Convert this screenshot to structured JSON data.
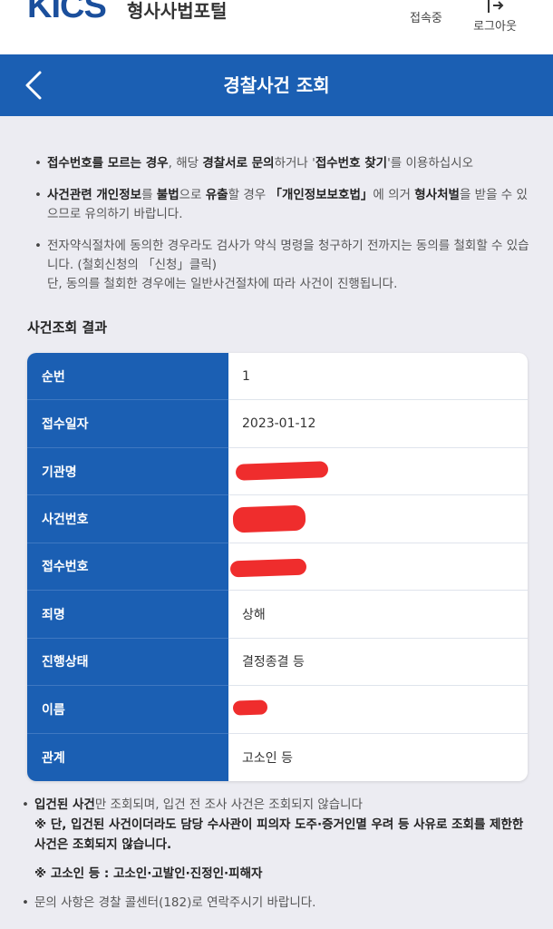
{
  "header": {
    "logo_text": "KICS",
    "portal_name": "형사사법포털",
    "status_text": "접속중",
    "logout_label": "로그아웃"
  },
  "navbar": {
    "title": "경찰사건 조회"
  },
  "notices": [
    {
      "segments": [
        {
          "text": "접수번호를 모르는 경우",
          "bold": true
        },
        {
          "text": ", 해당 ",
          "bold": false
        },
        {
          "text": "경찰서로 문의",
          "bold": true
        },
        {
          "text": "하거나 '",
          "bold": false
        },
        {
          "text": "접수번호 찾기",
          "bold": true
        },
        {
          "text": "'를 이용하십시오",
          "bold": false
        }
      ]
    },
    {
      "segments": [
        {
          "text": "사건관련 개인정보",
          "bold": true
        },
        {
          "text": "를 ",
          "bold": false
        },
        {
          "text": "불법",
          "bold": true
        },
        {
          "text": "으로 ",
          "bold": false
        },
        {
          "text": "유출",
          "bold": true
        },
        {
          "text": "할 경우 ",
          "bold": false
        },
        {
          "text": "「개인정보보호법」",
          "bold": true
        },
        {
          "text": "에 의거 ",
          "bold": false
        },
        {
          "text": "형사처벌",
          "bold": true
        },
        {
          "text": "을 받을 수 있으므로 유의하기 바랍니다.",
          "bold": false
        }
      ]
    },
    {
      "segments": [
        {
          "text": "전자약식절차에 동의한 경우라도 검사가 약식 명령을 청구하기 전까지는 동의를 철회할 수 있습니다. (철회신청의 「신청」클릭)",
          "bold": false
        }
      ],
      "extra": "단, 동의를 철회한 경우에는 일반사건절차에 따라 사건이 진행됩니다."
    }
  ],
  "result": {
    "section_title": "사건조회 결과",
    "rows": [
      {
        "label": "순번",
        "value": "1",
        "redacted": false
      },
      {
        "label": "접수일자",
        "value": "2023-01-12",
        "redacted": false
      },
      {
        "label": "기관명",
        "value": "",
        "redacted": true
      },
      {
        "label": "사건번호",
        "value": "",
        "redacted": true
      },
      {
        "label": "접수번호",
        "value": "",
        "redacted": true
      },
      {
        "label": "죄명",
        "value": "상해",
        "redacted": false
      },
      {
        "label": "진행상태",
        "value": "결정종결 등",
        "redacted": false
      },
      {
        "label": " 이름",
        "value": "",
        "redacted": true
      },
      {
        "label": "관계",
        "value": "고소인 등",
        "redacted": false
      }
    ]
  },
  "footnotes": {
    "line1_bold": "입건된 사건",
    "line1_rest": "만 조회되며, 입건 전 조사 사건은 조회되지 않습니다",
    "line2": "※ 단, 입건된 사건이더라도 담당 수사관이 피의자 도주·증거인멸 우려 등 사유로 조회를 제한한 사건은 조회되지 않습니다.",
    "line3": "※ 고소인 등 : 고소인·고발인·진정인·피해자",
    "line4": "문의 사항은 경찰 콜센터(182)로 연락주시기 바랍니다."
  },
  "colors": {
    "brand_blue": "#1b5fb3",
    "redaction": "#ee2222",
    "background": "#ececf2"
  }
}
